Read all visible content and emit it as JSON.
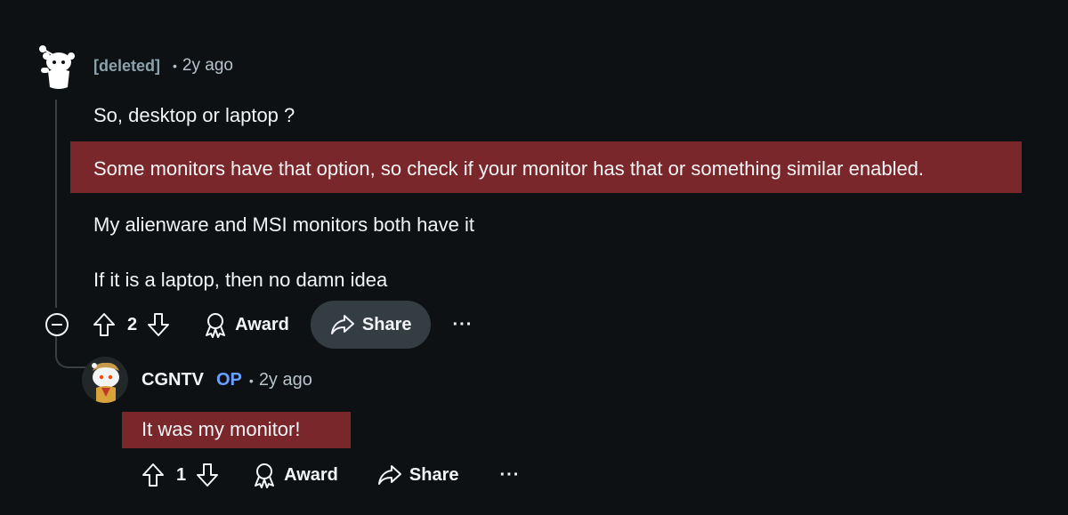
{
  "comment": {
    "author": "[deleted]",
    "separator": "•",
    "time": "2y ago",
    "paragraphs": [
      "So, desktop or laptop ?",
      "Some monitors have that option, so check if your monitor has that or something similar enabled.",
      "My alienware and MSI monitors both have it",
      "If it is a laptop, then no damn idea"
    ],
    "highlighted_paragraph_index": 1,
    "score": "2",
    "award_label": "Award",
    "share_label": "Share",
    "more_label": "···"
  },
  "reply": {
    "author": "CGNTV",
    "op_badge": "OP",
    "separator": "•",
    "time": "2y ago",
    "paragraphs": [
      "It was my monitor!"
    ],
    "score": "1",
    "award_label": "Award",
    "share_label": "Share",
    "more_label": "···"
  },
  "colors": {
    "background": "#0e1113",
    "highlight": "#7a272b",
    "op_badge": "#6aa0ff",
    "share_active_bg": "#333d42"
  },
  "icons": {
    "upvote": "upvote-arrow-icon",
    "downvote": "downvote-arrow-icon",
    "award": "award-ribbon-icon",
    "share": "share-arrow-icon",
    "collapse": "collapse-minus-icon"
  }
}
